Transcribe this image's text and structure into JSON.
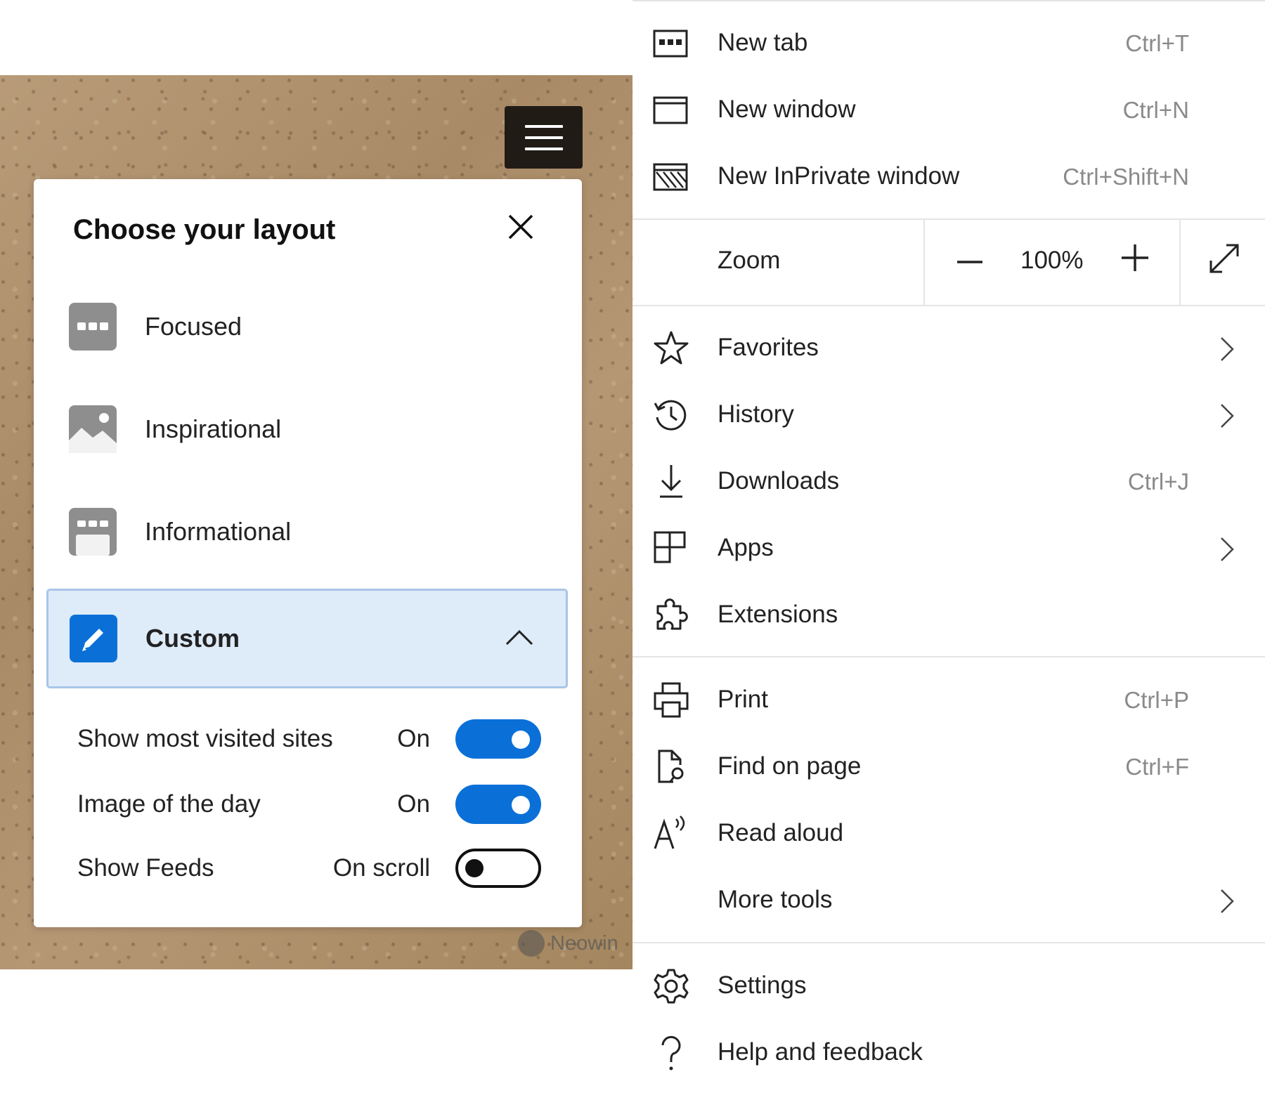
{
  "layout_panel": {
    "title": "Choose your layout",
    "options": [
      {
        "label": "Focused",
        "icon": "focused-layout-icon"
      },
      {
        "label": "Inspirational",
        "icon": "inspirational-layout-icon"
      },
      {
        "label": "Informational",
        "icon": "informational-layout-icon"
      },
      {
        "label": "Custom",
        "icon": "pencil-icon",
        "selected": true,
        "expanded": true
      }
    ],
    "settings": [
      {
        "label": "Show most visited sites",
        "state": "On",
        "toggle_on": true
      },
      {
        "label": "Image of the day",
        "state": "On",
        "toggle_on": true
      },
      {
        "label": "Show Feeds",
        "state": "On scroll",
        "toggle_on": false
      }
    ],
    "watermark": "Neowin",
    "accent_color": "#0a70d8",
    "selected_bg_color": "#deebf9"
  },
  "menu": {
    "items_group1": [
      {
        "label": "New tab",
        "shortcut": "Ctrl+T",
        "icon": "new-tab-icon"
      },
      {
        "label": "New window",
        "shortcut": "Ctrl+N",
        "icon": "new-window-icon"
      },
      {
        "label": "New InPrivate window",
        "shortcut": "Ctrl+Shift+N",
        "icon": "inprivate-icon"
      }
    ],
    "zoom": {
      "label": "Zoom",
      "value": "100%",
      "minus_icon": "minus-icon",
      "plus_icon": "plus-icon",
      "fullscreen_icon": "fullscreen-icon"
    },
    "items_group2": [
      {
        "label": "Favorites",
        "shortcut": "",
        "icon": "star-icon",
        "submenu": true
      },
      {
        "label": "History",
        "shortcut": "",
        "icon": "history-icon",
        "submenu": true
      },
      {
        "label": "Downloads",
        "shortcut": "Ctrl+J",
        "icon": "download-icon",
        "submenu": false
      },
      {
        "label": "Apps",
        "shortcut": "",
        "icon": "apps-icon",
        "submenu": true
      },
      {
        "label": "Extensions",
        "shortcut": "",
        "icon": "puzzle-icon",
        "submenu": false
      }
    ],
    "items_group3": [
      {
        "label": "Print",
        "shortcut": "Ctrl+P",
        "icon": "printer-icon",
        "submenu": false
      },
      {
        "label": "Find on page",
        "shortcut": "Ctrl+F",
        "icon": "find-icon",
        "submenu": false
      },
      {
        "label": "Read aloud",
        "shortcut": "",
        "icon": "read-aloud-icon",
        "submenu": false
      },
      {
        "label": "More tools",
        "shortcut": "",
        "icon": "",
        "submenu": true
      }
    ],
    "items_group4": [
      {
        "label": "Settings",
        "icon": "gear-icon"
      },
      {
        "label": "Help and feedback",
        "icon": "question-icon"
      }
    ]
  }
}
